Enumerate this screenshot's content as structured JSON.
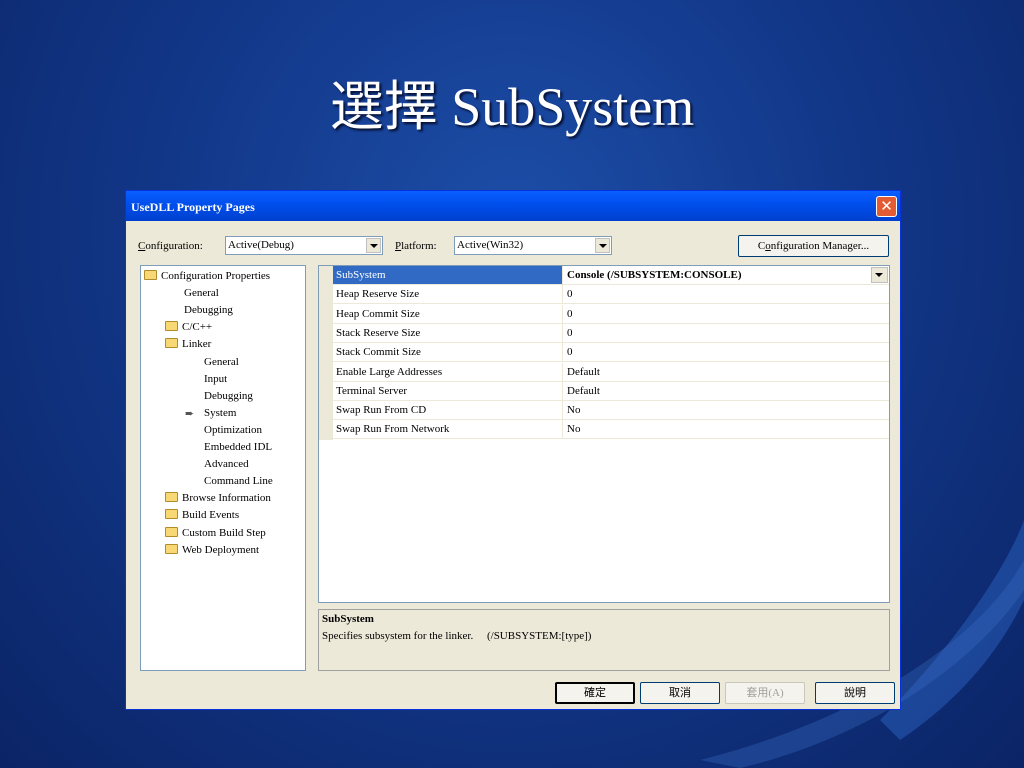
{
  "slide": {
    "title": "選擇 SubSystem"
  },
  "dialog": {
    "title": "UseDLL Property Pages",
    "close_glyph": "✕",
    "configuration_label": "onfiguration:",
    "configuration_label_accel": "C",
    "configuration_value": "Active(Debug)",
    "platform_label": "latform:",
    "platform_label_accel": "P",
    "platform_value": "Active(Win32)",
    "config_manager_label_pre": "C",
    "config_manager_label_accel": "o",
    "config_manager_label_post": "nfiguration Manager..."
  },
  "tree": [
    {
      "label": "Configuration Properties",
      "icon": "folder-open-icon",
      "indent": 0
    },
    {
      "label": "General",
      "icon": "",
      "indent": 1
    },
    {
      "label": "Debugging",
      "icon": "",
      "indent": 1
    },
    {
      "label": "C/C++",
      "icon": "folder-icon",
      "indent": 1
    },
    {
      "label": "Linker",
      "icon": "folder-open-icon",
      "indent": 1
    },
    {
      "label": "General",
      "icon": "",
      "indent": 2
    },
    {
      "label": "Input",
      "icon": "",
      "indent": 2
    },
    {
      "label": "Debugging",
      "icon": "",
      "indent": 2
    },
    {
      "label": "System",
      "icon": "arrow-icon",
      "indent": 2
    },
    {
      "label": "Optimization",
      "icon": "",
      "indent": 2
    },
    {
      "label": "Embedded IDL",
      "icon": "",
      "indent": 2
    },
    {
      "label": "Advanced",
      "icon": "",
      "indent": 2
    },
    {
      "label": "Command Line",
      "icon": "",
      "indent": 2
    },
    {
      "label": "Browse Information",
      "icon": "folder-icon",
      "indent": 1
    },
    {
      "label": "Build Events",
      "icon": "folder-icon",
      "indent": 1
    },
    {
      "label": "Custom Build Step",
      "icon": "folder-icon",
      "indent": 1
    },
    {
      "label": "Web Deployment",
      "icon": "folder-icon",
      "indent": 1
    }
  ],
  "properties": [
    {
      "name": "SubSystem",
      "value": "Console (/SUBSYSTEM:CONSOLE)",
      "selected": true
    },
    {
      "name": "Heap Reserve Size",
      "value": "0"
    },
    {
      "name": "Heap Commit Size",
      "value": "0"
    },
    {
      "name": "Stack Reserve Size",
      "value": "0"
    },
    {
      "name": "Stack Commit Size",
      "value": "0"
    },
    {
      "name": "Enable Large Addresses",
      "value": "Default"
    },
    {
      "name": "Terminal Server",
      "value": "Default"
    },
    {
      "name": "Swap Run From CD",
      "value": "No"
    },
    {
      "name": "Swap Run From Network",
      "value": "No"
    }
  ],
  "description": {
    "title": "SubSystem",
    "text": "Specifies subsystem for the linker.     (/SUBSYSTEM:[type])"
  },
  "buttons": {
    "ok": "確定",
    "cancel": "取消",
    "apply": "套用(A)",
    "help": "說明"
  }
}
